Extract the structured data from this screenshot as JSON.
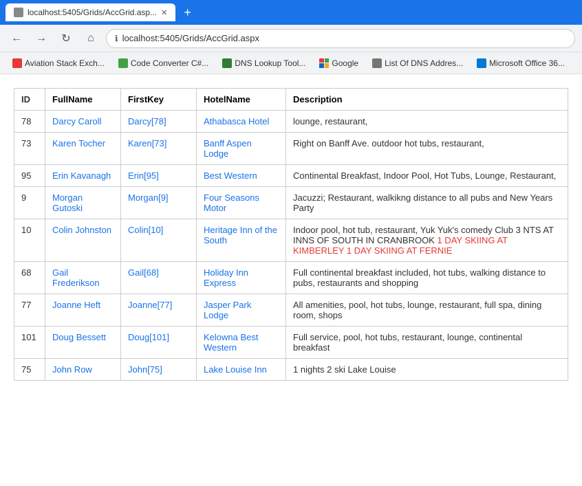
{
  "browser": {
    "tab_title": "localhost:5405/Grids/AccGrid.asp...",
    "tab_favicon": "page",
    "url": "localhost:5405/Grids/AccGrid.aspx",
    "new_tab_label": "+",
    "back_label": "←",
    "forward_label": "→",
    "reload_label": "↻",
    "home_label": "⌂"
  },
  "bookmarks": [
    {
      "label": "Aviation Stack Exch...",
      "color": "red"
    },
    {
      "label": "Code Converter C#...",
      "color": "green"
    },
    {
      "label": "DNS Lookup Tool...",
      "color": "darkgreen"
    },
    {
      "label": "Google",
      "color": "multi"
    },
    {
      "label": "List Of DNS Addres...",
      "color": "gray"
    },
    {
      "label": "Microsoft Office 36...",
      "color": "msblue"
    }
  ],
  "table": {
    "headers": [
      "ID",
      "FullName",
      "FirstKey",
      "HotelName",
      "Description"
    ],
    "rows": [
      {
        "id": "78",
        "fullname": "Darcy Caroll",
        "firstkey": "Darcy[78]",
        "hotelname": "Athabasca Hotel",
        "description": "lounge, restaurant,"
      },
      {
        "id": "73",
        "fullname": "Karen Tocher",
        "firstkey": "Karen[73]",
        "hotelname": "Banff Aspen Lodge",
        "description": "Right on Banff Ave. outdoor hot tubs, restaurant,"
      },
      {
        "id": "95",
        "fullname": "Erin Kavanagh",
        "firstkey": "Erin[95]",
        "hotelname": "Best Western",
        "description": "Continental Breakfast, Indoor Pool, Hot Tubs, Lounge, Restaurant,"
      },
      {
        "id": "9",
        "fullname": "Morgan Gutoski",
        "firstkey": "Morgan[9]",
        "hotelname": "Four Seasons Motor",
        "description": "Jacuzzi; Restaurant, walkikng distance to all pubs and New Years Party"
      },
      {
        "id": "10",
        "fullname": "Colin Johnston",
        "firstkey": "Colin[10]",
        "hotelname": "Heritage Inn of the South",
        "description_normal": "Indoor pool, hot tub, restaurant, Yuk Yuk's comedy Club 3 NTS AT INNS OF SOUTH IN CRANBROOK ",
        "description_highlight": "1 DAY SKIING AT KIMBERLEY 1 DAY SKIING AT FERNIE",
        "has_highlight": true
      },
      {
        "id": "68",
        "fullname": "Gail Frederikson",
        "firstkey": "Gail[68]",
        "hotelname": "Holiday Inn Express",
        "description": "Full continental breakfast included, hot tubs, walking distance to pubs, restaurants and shopping"
      },
      {
        "id": "77",
        "fullname": "Joanne Heft",
        "firstkey": "Joanne[77]",
        "hotelname": "Jasper Park Lodge",
        "description": "All amenities, pool, hot tubs, lounge, restaurant, full spa, dining room, shops"
      },
      {
        "id": "101",
        "fullname": "Doug Bessett",
        "firstkey": "Doug[101]",
        "hotelname": "Kelowna Best Western",
        "description": "Full service, pool, hot tubs, restaurant, lounge, continental breakfast"
      },
      {
        "id": "75",
        "fullname": "John Row",
        "firstkey": "John[75]",
        "hotelname": "Lake Louise Inn",
        "description": "1 nights 2 ski Lake Louise"
      }
    ]
  }
}
